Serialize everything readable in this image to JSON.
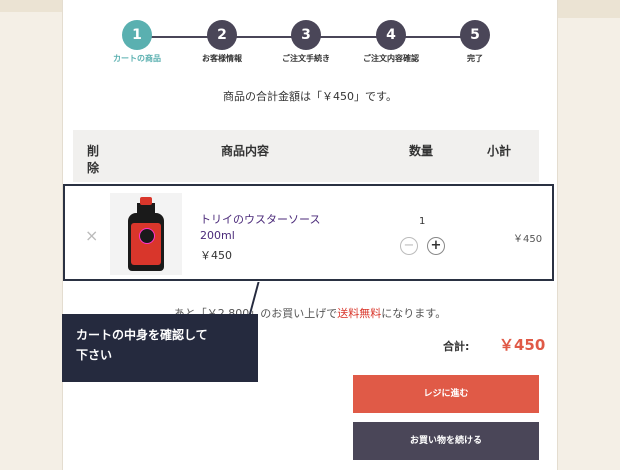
{
  "steps": [
    {
      "number": "1",
      "label": "カートの商品",
      "active": true
    },
    {
      "number": "2",
      "label": "お客様情報",
      "active": false
    },
    {
      "number": "3",
      "label": "ご注文手続き",
      "active": false
    },
    {
      "number": "4",
      "label": "ご注文内容確認",
      "active": false
    },
    {
      "number": "5",
      "label": "完了",
      "active": false
    }
  ],
  "total_message": "商品の合計金額は「￥450」です。",
  "table_header": {
    "remove_l1": "削",
    "remove_l2": "除",
    "product": "商品内容",
    "quantity": "数量",
    "subtotal": "小計"
  },
  "item": {
    "remove_symbol": "×",
    "name": "トリイのウスターソース",
    "size": "200ml",
    "price": "￥450",
    "quantity": "1",
    "minus": "−",
    "plus": "+",
    "subtotal": "￥450"
  },
  "shipping": {
    "prefix": "あと「￥2,800」のお買い上げで",
    "free": "送料無料",
    "suffix": "になります。"
  },
  "summary": {
    "label": "合計:",
    "value": "￥450"
  },
  "buttons": {
    "checkout": "レジに進む",
    "continue": "お買い物を続ける"
  },
  "tooltip": {
    "line1": "カートの中身を確認して",
    "line2": "下さい"
  },
  "colors": {
    "accent": "#5ab0b0",
    "dark": "#4a4658",
    "cta": "#e05a47",
    "tooltip": "#252a3e"
  }
}
